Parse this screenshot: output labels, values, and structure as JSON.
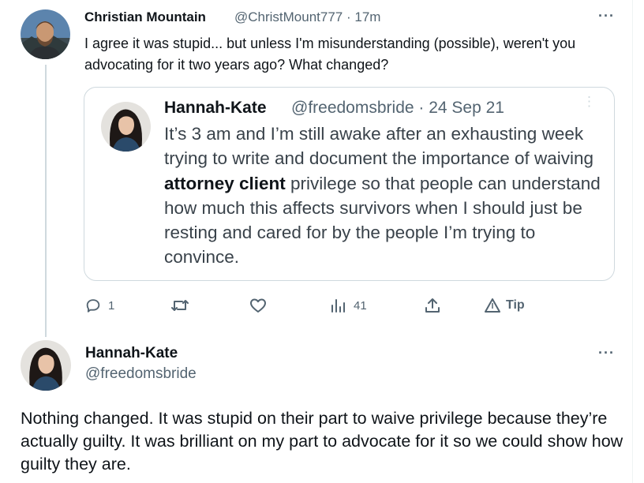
{
  "tweet1": {
    "author_name": "Christian Mountain",
    "handle_meta": "@ChristMount777 · 17m",
    "text": "I agree it was stupid... but unless I'm misunderstanding (possible), weren't you advocating for it two years ago?  What changed?",
    "more_glyph": "···",
    "quoted": {
      "author_name": "Hannah-Kate",
      "handle_meta": "@freedomsbride · 24 Sep 21",
      "text_before": "It’s 3 am and I’m still awake after an exhausting week trying to write and document the importance of waiving ",
      "text_bold": "attorney client",
      "text_after": " privilege so that people can understand how much this affects survivors when I should just be resting and cared for by the people I’m trying to convince.",
      "more_glyph": "⋮"
    },
    "actions": {
      "reply_count": "1",
      "retweet_count": "",
      "like_count": "",
      "views_count": "41",
      "tip_label": "Tip"
    }
  },
  "tweet2": {
    "author_name": "Hannah-Kate",
    "handle": "@freedomsbride",
    "text": "Nothing changed. It was stupid on their part to waive privilege because they’re actually guilty. It was brilliant on my part to advocate for it so we could show how guilty they are.",
    "more_glyph": "···"
  },
  "colors": {
    "secondary_text": "#536471",
    "border": "#cfd9de",
    "thread_line": "#cfd9de"
  }
}
